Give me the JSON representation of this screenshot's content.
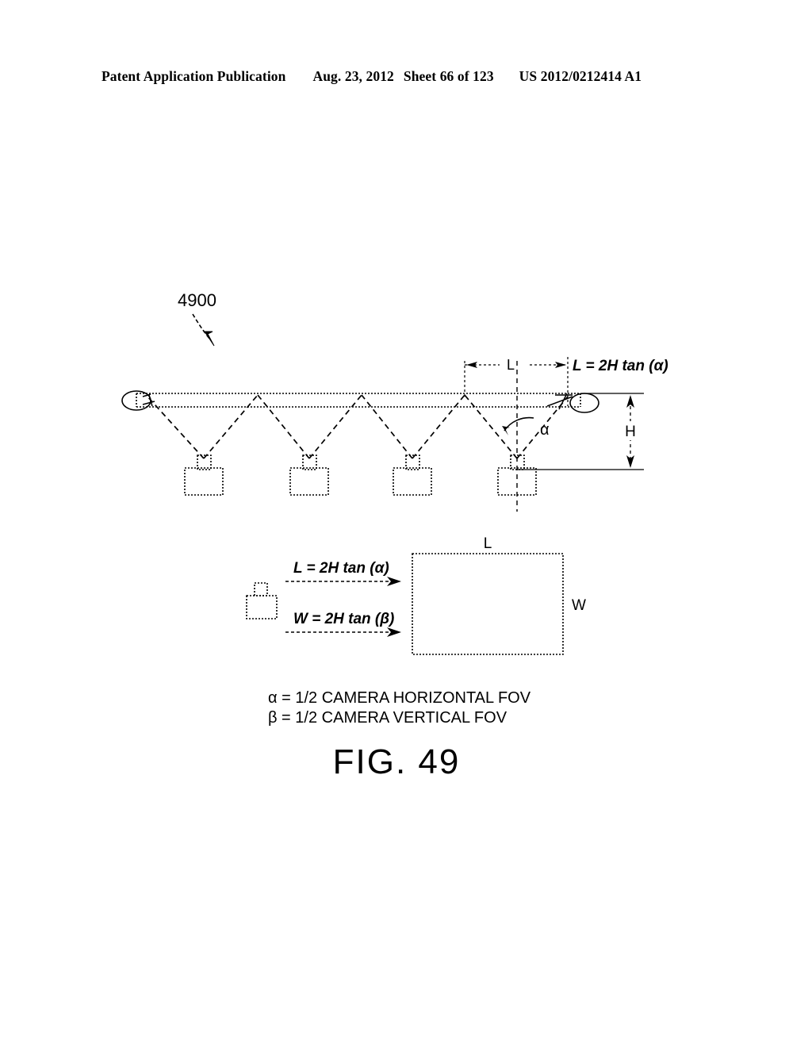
{
  "header": {
    "publication": "Patent Application Publication",
    "date": "Aug. 23, 2012",
    "sheet": "Sheet 66 of 123",
    "patent_number": "US 2012/0212414 A1"
  },
  "figure": {
    "caption": "FIG. 49",
    "reference_numeral": "4900",
    "top_diagram": {
      "dimension_l_label": "L",
      "dimension_h_label": "H",
      "angle_label": "α",
      "formula_l": "L = 2H tan (α)",
      "camera_count": 4
    },
    "bottom_diagram": {
      "formula_l": "L = 2H tan (α)",
      "formula_w": "W = 2H tan (β)",
      "rect_top_label": "L",
      "rect_side_label": "W"
    },
    "legend": {
      "line1": "α = 1/2 CAMERA HORIZONTAL FOV",
      "line2": "β = 1/2 CAMERA VERTICAL FOV"
    }
  },
  "colors": {
    "ink": "#000000",
    "paper": "#ffffff"
  }
}
